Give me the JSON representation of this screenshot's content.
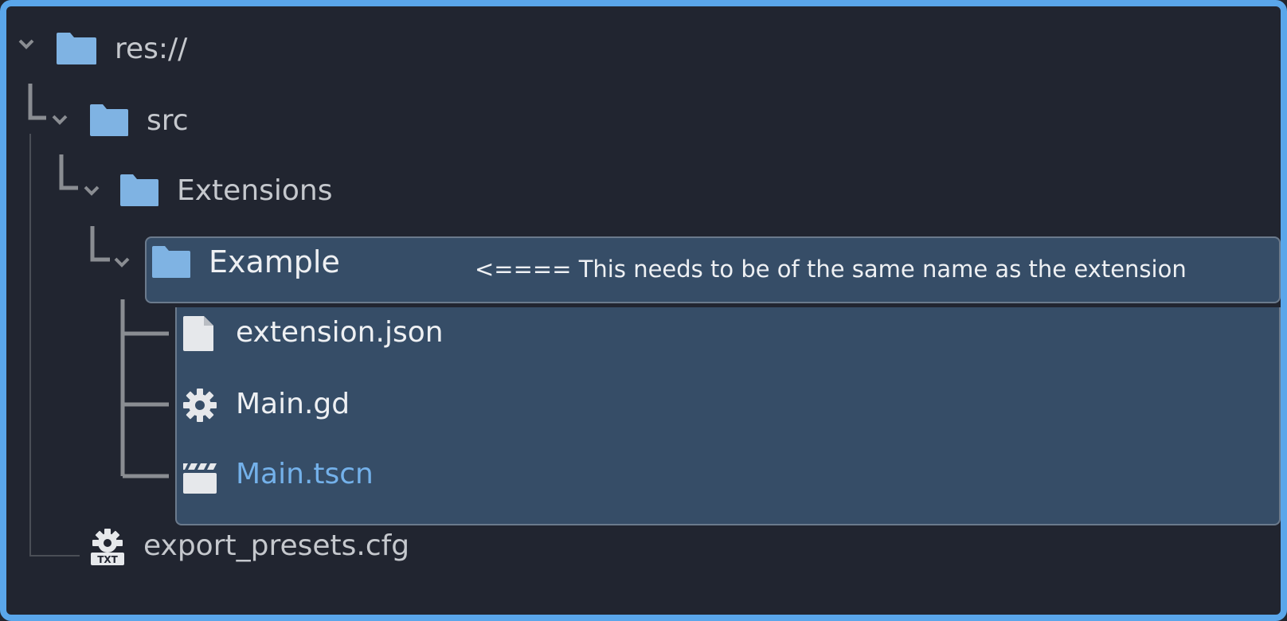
{
  "tree": {
    "root": {
      "label": "res://",
      "icon": "folder-icon"
    },
    "src": {
      "label": "src",
      "icon": "folder-icon"
    },
    "extensions": {
      "label": "Extensions",
      "icon": "folder-icon"
    },
    "example": {
      "label": "Example",
      "icon": "folder-icon",
      "annotation": "<==== This needs to be of the same name as the extension"
    },
    "files": [
      {
        "label": "extension.json",
        "icon": "file-icon"
      },
      {
        "label": "Main.gd",
        "icon": "gear-icon"
      },
      {
        "label": "Main.tscn",
        "icon": "clapperboard-icon"
      }
    ],
    "export_presets": {
      "label": "export_presets.cfg",
      "icon": "config-file-icon"
    }
  },
  "colors": {
    "background": "#212530",
    "border": "#5aa6ea",
    "folder": "#7fb3e3",
    "highlight": "#364d67",
    "scene_text": "#74b1ea"
  }
}
